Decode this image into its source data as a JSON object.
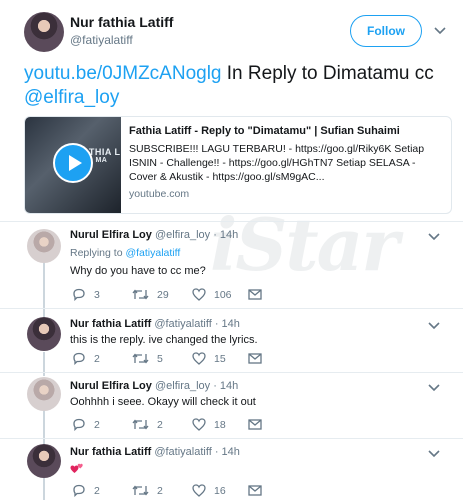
{
  "main_tweet": {
    "name": "Nur fathia Latiff",
    "handle": "@fatiyalatiff",
    "follow_label": "Follow",
    "text_link": "youtu.be/0JMZcANoglg",
    "text_middle": " In Reply to Dimatamu cc ",
    "text_mention": "@elfira_loy",
    "card": {
      "thumb_text_1": "FATHIA L",
      "thumb_text_2": "DI MA",
      "title": "Fathia Latiff - Reply to \"Dimatamu\" | Sufian Suhaimi",
      "description": "SUBSCRIBE!!! LAGU TERBARU! - https://goo.gl/Riky6K Setiap ISNIN - Challenge!! - https://goo.gl/HGhTN7 Setiap SELASA - Cover & Akustik - https://goo.gl/sM9gAC...",
      "domain": "youtube.com"
    }
  },
  "watermark": "iStar",
  "replies": [
    {
      "name": "Nurul Elfira Loy",
      "meta": " @elfira_loy · 14h",
      "replying_prefix": "Replying to ",
      "replying_handle": "@fatiyalatiff",
      "text": "Why do you have to cc me?",
      "replies": "3",
      "retweets": "29",
      "likes": "106"
    },
    {
      "name": "Nur fathia Latiff",
      "meta": " @fatiyalatiff · 14h",
      "text": "this is the reply. ive changed the lyrics.",
      "replies": "2",
      "retweets": "5",
      "likes": "15"
    },
    {
      "name": "Nurul Elfira Loy",
      "meta": " @elfira_loy · 14h",
      "text": "Oohhhh i seee. Okayy will check it out",
      "replies": "2",
      "retweets": "2",
      "likes": "18"
    },
    {
      "name": "Nur fathia Latiff",
      "meta": " @fatiyalatiff · 14h",
      "text": "",
      "emoji": "two-hearts",
      "replies": "2",
      "retweets": "2",
      "likes": "16"
    }
  ],
  "colors": {
    "accent": "#1da1f2",
    "muted": "#657786",
    "border": "#e6ecf0",
    "heart": "#e0245e"
  }
}
